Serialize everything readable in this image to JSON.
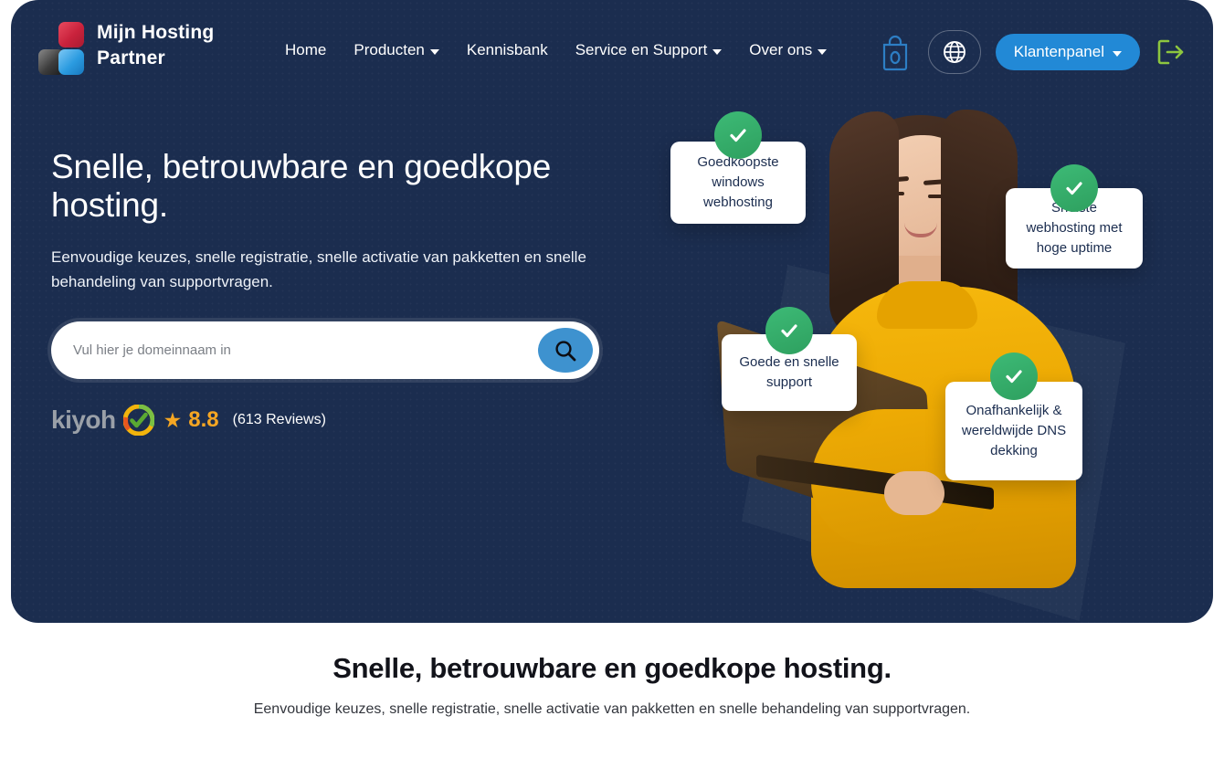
{
  "brand": {
    "line1": "Mijn Hosting",
    "line2": "Partner",
    "logo_colors": {
      "red": "#c9223c",
      "gray": "#3c3c3c",
      "blue": "#2b9be0"
    }
  },
  "nav": {
    "items": [
      {
        "label": "Home",
        "has_caret": false
      },
      {
        "label": "Producten",
        "has_caret": true
      },
      {
        "label": "Kennisbank",
        "has_caret": false
      },
      {
        "label": "Service en Support",
        "has_caret": true
      },
      {
        "label": "Over ons",
        "has_caret": true
      }
    ]
  },
  "header_actions": {
    "cart_count": "0",
    "cart_icon": "shopping-bag-icon",
    "language_icon": "globe-icon",
    "customer_panel_label": "Klantenpanel",
    "logout_icon": "logout-arrow-icon",
    "accent_blue": "#2289d6",
    "logout_green": "#8dc63f"
  },
  "hero": {
    "title": "Snelle, betrouwbare en goedkope hosting.",
    "subtitle": "Eenvoudige keuzes, snelle registratie, snelle activatie van pakketten en snelle behandeling van supportvragen.",
    "search_placeholder": "Vul hier je domeinnaam in",
    "search_value": "",
    "search_icon": "search-icon",
    "panel_color": "#1b2d4f"
  },
  "rating": {
    "brand": "kiyoh",
    "star": "★",
    "score": "8.8",
    "reviews": "(613 Reviews)",
    "star_color": "#f5a623"
  },
  "feature_cards": [
    {
      "label": "Goedkoopste windows webhosting",
      "icon": "check-icon"
    },
    {
      "label": "Snelste webhosting met hoge uptime",
      "icon": "check-icon"
    },
    {
      "label": "Goede en snelle support",
      "icon": "check-icon"
    },
    {
      "label": "Onafhankelijk & wereldwijde DNS dekking",
      "icon": "check-icon"
    }
  ],
  "bottom": {
    "title": "Snelle, betrouwbare en goedkope hosting.",
    "subtitle": "Eenvoudige keuzes, snelle registratie, snelle activatie van pakketten en snelle behandeling van supportvragen."
  }
}
